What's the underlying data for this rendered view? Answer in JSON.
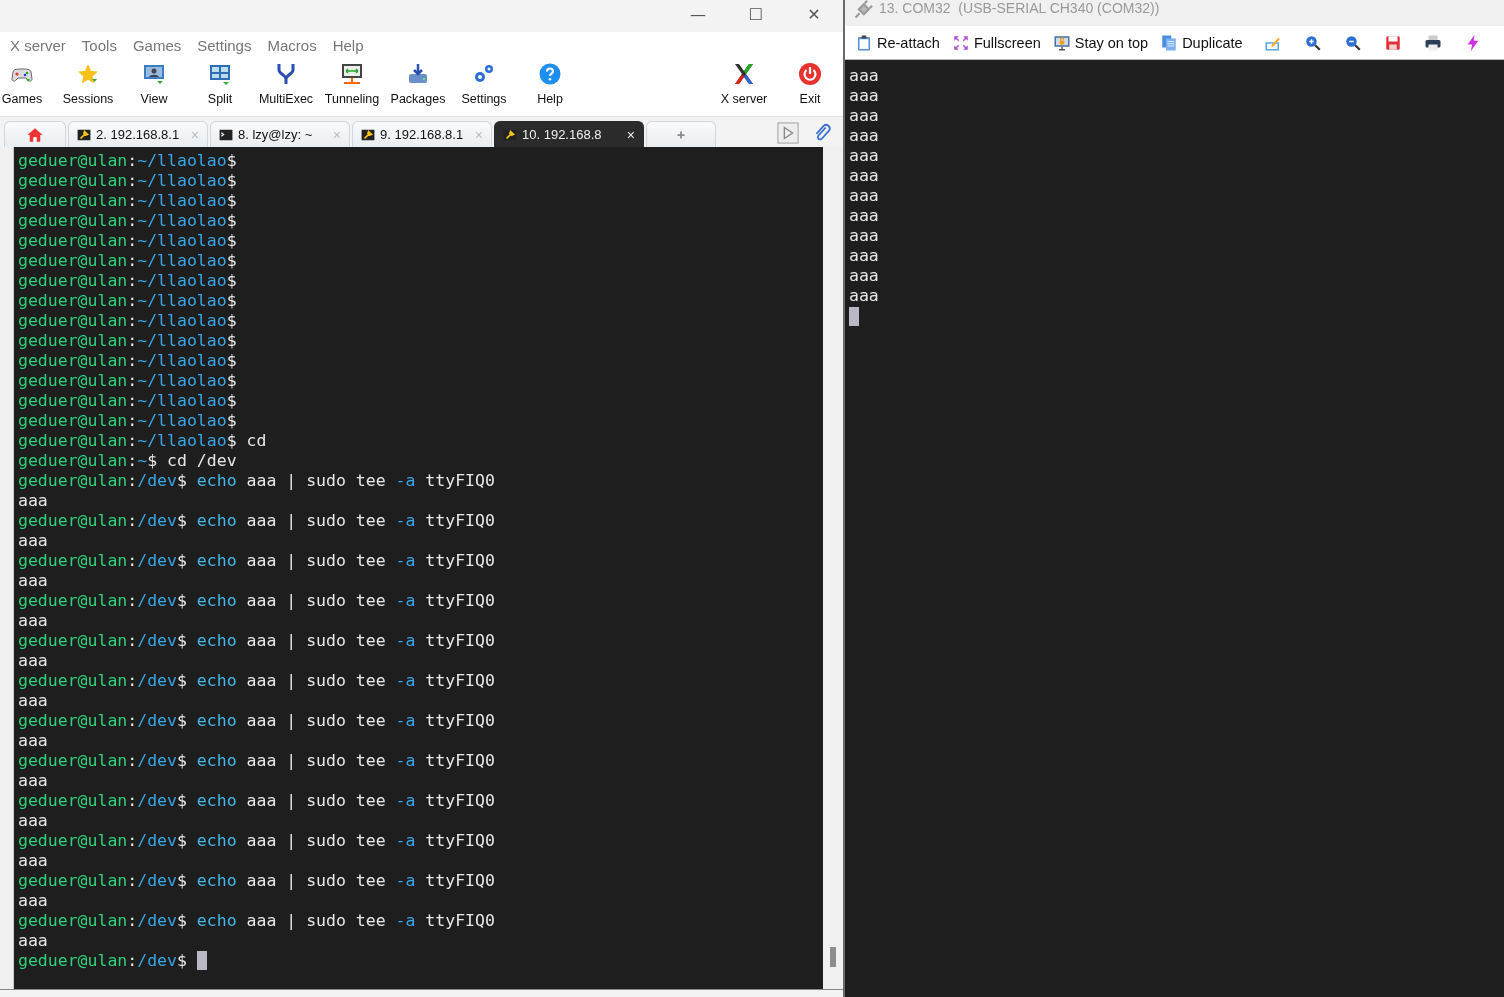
{
  "main_window": {
    "window_controls": [
      "—",
      "☐",
      "✕"
    ],
    "menu": [
      "X server",
      "Tools",
      "Games",
      "Settings",
      "Macros",
      "Help"
    ],
    "toolbar": [
      {
        "label": "Games",
        "kind": "left"
      },
      {
        "label": "Sessions",
        "kind": "left"
      },
      {
        "label": "View",
        "kind": "left"
      },
      {
        "label": "Split",
        "kind": "left"
      },
      {
        "label": "MultiExec",
        "kind": "left"
      },
      {
        "label": "Tunneling",
        "kind": "left"
      },
      {
        "label": "Packages",
        "kind": "left"
      },
      {
        "label": "Settings",
        "kind": "left"
      },
      {
        "label": "Help",
        "kind": "left"
      },
      {
        "label": "X server",
        "kind": "right"
      },
      {
        "label": "Exit",
        "kind": "right"
      }
    ],
    "tabs": [
      {
        "kind": "home",
        "selected": false
      },
      {
        "kind": "ssh",
        "label": "2. 192.168.8.1",
        "close": "×",
        "selected": false
      },
      {
        "kind": "shell",
        "label": "8. lzy@lzy: ~",
        "close": "×",
        "selected": false
      },
      {
        "kind": "ssh",
        "label": "9. 192.168.8.1",
        "close": "×",
        "selected": false
      },
      {
        "kind": "ssh",
        "label": "10. 192.168.8",
        "close": "×",
        "selected": true
      },
      {
        "kind": "new",
        "selected": false
      }
    ],
    "terminal": {
      "cursor": true,
      "lines": [
        [
          {
            "kind": "user",
            "text": "geduer@ulan"
          },
          {
            "kind": "plain",
            "text": ":"
          },
          {
            "kind": "path",
            "text": "~/llaolao"
          },
          {
            "kind": "plain",
            "text": "$"
          }
        ],
        [
          {
            "kind": "user",
            "text": "geduer@ulan"
          },
          {
            "kind": "plain",
            "text": ":"
          },
          {
            "kind": "path",
            "text": "~/llaolao"
          },
          {
            "kind": "plain",
            "text": "$"
          }
        ],
        [
          {
            "kind": "user",
            "text": "geduer@ulan"
          },
          {
            "kind": "plain",
            "text": ":"
          },
          {
            "kind": "path",
            "text": "~/llaolao"
          },
          {
            "kind": "plain",
            "text": "$"
          }
        ],
        [
          {
            "kind": "user",
            "text": "geduer@ulan"
          },
          {
            "kind": "plain",
            "text": ":"
          },
          {
            "kind": "path",
            "text": "~/llaolao"
          },
          {
            "kind": "plain",
            "text": "$"
          }
        ],
        [
          {
            "kind": "user",
            "text": "geduer@ulan"
          },
          {
            "kind": "plain",
            "text": ":"
          },
          {
            "kind": "path",
            "text": "~/llaolao"
          },
          {
            "kind": "plain",
            "text": "$"
          }
        ],
        [
          {
            "kind": "user",
            "text": "geduer@ulan"
          },
          {
            "kind": "plain",
            "text": ":"
          },
          {
            "kind": "path",
            "text": "~/llaolao"
          },
          {
            "kind": "plain",
            "text": "$"
          }
        ],
        [
          {
            "kind": "user",
            "text": "geduer@ulan"
          },
          {
            "kind": "plain",
            "text": ":"
          },
          {
            "kind": "path",
            "text": "~/llaolao"
          },
          {
            "kind": "plain",
            "text": "$"
          }
        ],
        [
          {
            "kind": "user",
            "text": "geduer@ulan"
          },
          {
            "kind": "plain",
            "text": ":"
          },
          {
            "kind": "path",
            "text": "~/llaolao"
          },
          {
            "kind": "plain",
            "text": "$"
          }
        ],
        [
          {
            "kind": "user",
            "text": "geduer@ulan"
          },
          {
            "kind": "plain",
            "text": ":"
          },
          {
            "kind": "path",
            "text": "~/llaolao"
          },
          {
            "kind": "plain",
            "text": "$"
          }
        ],
        [
          {
            "kind": "user",
            "text": "geduer@ulan"
          },
          {
            "kind": "plain",
            "text": ":"
          },
          {
            "kind": "path",
            "text": "~/llaolao"
          },
          {
            "kind": "plain",
            "text": "$"
          }
        ],
        [
          {
            "kind": "user",
            "text": "geduer@ulan"
          },
          {
            "kind": "plain",
            "text": ":"
          },
          {
            "kind": "path",
            "text": "~/llaolao"
          },
          {
            "kind": "plain",
            "text": "$"
          }
        ],
        [
          {
            "kind": "user",
            "text": "geduer@ulan"
          },
          {
            "kind": "plain",
            "text": ":"
          },
          {
            "kind": "path",
            "text": "~/llaolao"
          },
          {
            "kind": "plain",
            "text": "$"
          }
        ],
        [
          {
            "kind": "user",
            "text": "geduer@ulan"
          },
          {
            "kind": "plain",
            "text": ":"
          },
          {
            "kind": "path",
            "text": "~/llaolao"
          },
          {
            "kind": "plain",
            "text": "$"
          }
        ],
        [
          {
            "kind": "user",
            "text": "geduer@ulan"
          },
          {
            "kind": "plain",
            "text": ":"
          },
          {
            "kind": "path",
            "text": "~/llaolao"
          },
          {
            "kind": "plain",
            "text": "$"
          }
        ],
        [
          {
            "kind": "user",
            "text": "geduer@ulan"
          },
          {
            "kind": "plain",
            "text": ":"
          },
          {
            "kind": "path",
            "text": "~/llaolao"
          },
          {
            "kind": "plain",
            "text": "$ cd"
          }
        ],
        [
          {
            "kind": "user",
            "text": "geduer@ulan"
          },
          {
            "kind": "plain",
            "text": ":"
          },
          {
            "kind": "path",
            "text": "~"
          },
          {
            "kind": "plain",
            "text": "$ cd /dev"
          }
        ],
        [
          {
            "kind": "user",
            "text": "geduer@ulan"
          },
          {
            "kind": "plain",
            "text": ":"
          },
          {
            "kind": "path",
            "text": "/dev"
          },
          {
            "kind": "plain",
            "text": "$ "
          },
          {
            "kind": "keyword",
            "text": "echo"
          },
          {
            "kind": "plain",
            "text": " aaa | sudo tee "
          },
          {
            "kind": "option",
            "text": "-a"
          },
          {
            "kind": "plain",
            "text": " ttyFIQ0"
          }
        ],
        [
          {
            "kind": "plain",
            "text": "aaa"
          }
        ],
        [
          {
            "kind": "user",
            "text": "geduer@ulan"
          },
          {
            "kind": "plain",
            "text": ":"
          },
          {
            "kind": "path",
            "text": "/dev"
          },
          {
            "kind": "plain",
            "text": "$ "
          },
          {
            "kind": "keyword",
            "text": "echo"
          },
          {
            "kind": "plain",
            "text": " aaa | sudo tee "
          },
          {
            "kind": "option",
            "text": "-a"
          },
          {
            "kind": "plain",
            "text": " ttyFIQ0"
          }
        ],
        [
          {
            "kind": "plain",
            "text": "aaa"
          }
        ],
        [
          {
            "kind": "user",
            "text": "geduer@ulan"
          },
          {
            "kind": "plain",
            "text": ":"
          },
          {
            "kind": "path",
            "text": "/dev"
          },
          {
            "kind": "plain",
            "text": "$ "
          },
          {
            "kind": "keyword",
            "text": "echo"
          },
          {
            "kind": "plain",
            "text": " aaa | sudo tee "
          },
          {
            "kind": "option",
            "text": "-a"
          },
          {
            "kind": "plain",
            "text": " ttyFIQ0"
          }
        ],
        [
          {
            "kind": "plain",
            "text": "aaa"
          }
        ],
        [
          {
            "kind": "user",
            "text": "geduer@ulan"
          },
          {
            "kind": "plain",
            "text": ":"
          },
          {
            "kind": "path",
            "text": "/dev"
          },
          {
            "kind": "plain",
            "text": "$ "
          },
          {
            "kind": "keyword",
            "text": "echo"
          },
          {
            "kind": "plain",
            "text": " aaa | sudo tee "
          },
          {
            "kind": "option",
            "text": "-a"
          },
          {
            "kind": "plain",
            "text": " ttyFIQ0"
          }
        ],
        [
          {
            "kind": "plain",
            "text": "aaa"
          }
        ],
        [
          {
            "kind": "user",
            "text": "geduer@ulan"
          },
          {
            "kind": "plain",
            "text": ":"
          },
          {
            "kind": "path",
            "text": "/dev"
          },
          {
            "kind": "plain",
            "text": "$ "
          },
          {
            "kind": "keyword",
            "text": "echo"
          },
          {
            "kind": "plain",
            "text": " aaa | sudo tee "
          },
          {
            "kind": "option",
            "text": "-a"
          },
          {
            "kind": "plain",
            "text": " ttyFIQ0"
          }
        ],
        [
          {
            "kind": "plain",
            "text": "aaa"
          }
        ],
        [
          {
            "kind": "user",
            "text": "geduer@ulan"
          },
          {
            "kind": "plain",
            "text": ":"
          },
          {
            "kind": "path",
            "text": "/dev"
          },
          {
            "kind": "plain",
            "text": "$ "
          },
          {
            "kind": "keyword",
            "text": "echo"
          },
          {
            "kind": "plain",
            "text": " aaa | sudo tee "
          },
          {
            "kind": "option",
            "text": "-a"
          },
          {
            "kind": "plain",
            "text": " ttyFIQ0"
          }
        ],
        [
          {
            "kind": "plain",
            "text": "aaa"
          }
        ],
        [
          {
            "kind": "user",
            "text": "geduer@ulan"
          },
          {
            "kind": "plain",
            "text": ":"
          },
          {
            "kind": "path",
            "text": "/dev"
          },
          {
            "kind": "plain",
            "text": "$ "
          },
          {
            "kind": "keyword",
            "text": "echo"
          },
          {
            "kind": "plain",
            "text": " aaa | sudo tee "
          },
          {
            "kind": "option",
            "text": "-a"
          },
          {
            "kind": "plain",
            "text": " ttyFIQ0"
          }
        ],
        [
          {
            "kind": "plain",
            "text": "aaa"
          }
        ],
        [
          {
            "kind": "user",
            "text": "geduer@ulan"
          },
          {
            "kind": "plain",
            "text": ":"
          },
          {
            "kind": "path",
            "text": "/dev"
          },
          {
            "kind": "plain",
            "text": "$ "
          },
          {
            "kind": "keyword",
            "text": "echo"
          },
          {
            "kind": "plain",
            "text": " aaa | sudo tee "
          },
          {
            "kind": "option",
            "text": "-a"
          },
          {
            "kind": "plain",
            "text": " ttyFIQ0"
          }
        ],
        [
          {
            "kind": "plain",
            "text": "aaa"
          }
        ],
        [
          {
            "kind": "user",
            "text": "geduer@ulan"
          },
          {
            "kind": "plain",
            "text": ":"
          },
          {
            "kind": "path",
            "text": "/dev"
          },
          {
            "kind": "plain",
            "text": "$ "
          },
          {
            "kind": "keyword",
            "text": "echo"
          },
          {
            "kind": "plain",
            "text": " aaa | sudo tee "
          },
          {
            "kind": "option",
            "text": "-a"
          },
          {
            "kind": "plain",
            "text": " ttyFIQ0"
          }
        ],
        [
          {
            "kind": "plain",
            "text": "aaa"
          }
        ],
        [
          {
            "kind": "user",
            "text": "geduer@ulan"
          },
          {
            "kind": "plain",
            "text": ":"
          },
          {
            "kind": "path",
            "text": "/dev"
          },
          {
            "kind": "plain",
            "text": "$ "
          },
          {
            "kind": "keyword",
            "text": "echo"
          },
          {
            "kind": "plain",
            "text": " aaa | sudo tee "
          },
          {
            "kind": "option",
            "text": "-a"
          },
          {
            "kind": "plain",
            "text": " ttyFIQ0"
          }
        ],
        [
          {
            "kind": "plain",
            "text": "aaa"
          }
        ],
        [
          {
            "kind": "user",
            "text": "geduer@ulan"
          },
          {
            "kind": "plain",
            "text": ":"
          },
          {
            "kind": "path",
            "text": "/dev"
          },
          {
            "kind": "plain",
            "text": "$ "
          },
          {
            "kind": "keyword",
            "text": "echo"
          },
          {
            "kind": "plain",
            "text": " aaa | sudo tee "
          },
          {
            "kind": "option",
            "text": "-a"
          },
          {
            "kind": "plain",
            "text": " ttyFIQ0"
          }
        ],
        [
          {
            "kind": "plain",
            "text": "aaa"
          }
        ],
        [
          {
            "kind": "user",
            "text": "geduer@ulan"
          },
          {
            "kind": "plain",
            "text": ":"
          },
          {
            "kind": "path",
            "text": "/dev"
          },
          {
            "kind": "plain",
            "text": "$ "
          },
          {
            "kind": "keyword",
            "text": "echo"
          },
          {
            "kind": "plain",
            "text": " aaa | sudo tee "
          },
          {
            "kind": "option",
            "text": "-a"
          },
          {
            "kind": "plain",
            "text": " ttyFIQ0"
          }
        ],
        [
          {
            "kind": "plain",
            "text": "aaa"
          }
        ],
        [
          {
            "kind": "user",
            "text": "geduer@ulan"
          },
          {
            "kind": "plain",
            "text": ":"
          },
          {
            "kind": "path",
            "text": "/dev"
          },
          {
            "kind": "plain",
            "text": "$ "
          }
        ]
      ]
    }
  },
  "serial_window": {
    "title": "13. COM32  (USB-SERIAL CH340 (COM32))",
    "toolbar": [
      {
        "kind": "labeled",
        "label": "Re-attach"
      },
      {
        "kind": "labeled",
        "label": "Fullscreen"
      },
      {
        "kind": "labeled",
        "label": "Stay on top"
      },
      {
        "kind": "labeled",
        "label": "Duplicate"
      },
      {
        "kind": "icon"
      },
      {
        "kind": "icon"
      },
      {
        "kind": "icon"
      },
      {
        "kind": "icon"
      },
      {
        "kind": "icon"
      },
      {
        "kind": "icon"
      }
    ],
    "terminal": {
      "cursor": true,
      "lines": [
        [
          {
            "kind": "plain",
            "text": "aaa"
          }
        ],
        [
          {
            "kind": "plain",
            "text": "aaa"
          }
        ],
        [
          {
            "kind": "plain",
            "text": "aaa"
          }
        ],
        [
          {
            "kind": "plain",
            "text": "aaa"
          }
        ],
        [
          {
            "kind": "plain",
            "text": "aaa"
          }
        ],
        [
          {
            "kind": "plain",
            "text": "aaa"
          }
        ],
        [
          {
            "kind": "plain",
            "text": "aaa"
          }
        ],
        [
          {
            "kind": "plain",
            "text": "aaa"
          }
        ],
        [
          {
            "kind": "plain",
            "text": "aaa"
          }
        ],
        [
          {
            "kind": "plain",
            "text": "aaa"
          }
        ],
        [
          {
            "kind": "plain",
            "text": "aaa"
          }
        ],
        [
          {
            "kind": "plain",
            "text": "aaa"
          }
        ]
      ]
    }
  }
}
